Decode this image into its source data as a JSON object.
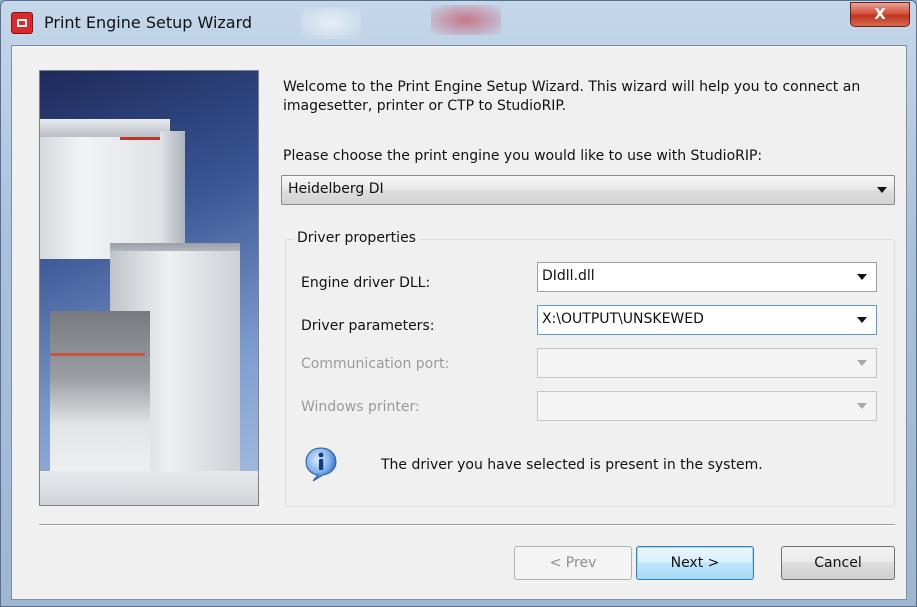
{
  "window": {
    "title": "Print Engine Setup Wizard",
    "close_glyph": "X"
  },
  "content": {
    "welcome": "Welcome to the Print Engine Setup Wizard. This wizard will help you to connect an imagesetter, printer or CTP to StudioRIP.",
    "choose_prompt": "Please choose the print engine you would like to use with StudioRIP:",
    "engine_selected": "Heidelberg DI"
  },
  "driver_properties": {
    "title": "Driver properties",
    "fields": [
      {
        "label": "Engine driver DLL:",
        "value": "DIdll.dll",
        "enabled": true
      },
      {
        "label": "Driver parameters:",
        "value": "X:\\OUTPUT\\UNSKEWED",
        "enabled": true
      },
      {
        "label": "Communication port:",
        "value": "",
        "enabled": false
      },
      {
        "label": "Windows printer:",
        "value": "",
        "enabled": false
      }
    ],
    "info_message": "The driver you have selected is present in the system."
  },
  "buttons": {
    "prev": "< Prev",
    "next": "Next >",
    "cancel": "Cancel"
  },
  "icons": {
    "app": "print-engine-icon",
    "info": "info-balloon-icon",
    "dropdown": "chevron-down-icon"
  },
  "colors": {
    "title_close": "#c0341e",
    "info_blue": "#2a66c4",
    "default_button_border": "#3c7fb1"
  }
}
